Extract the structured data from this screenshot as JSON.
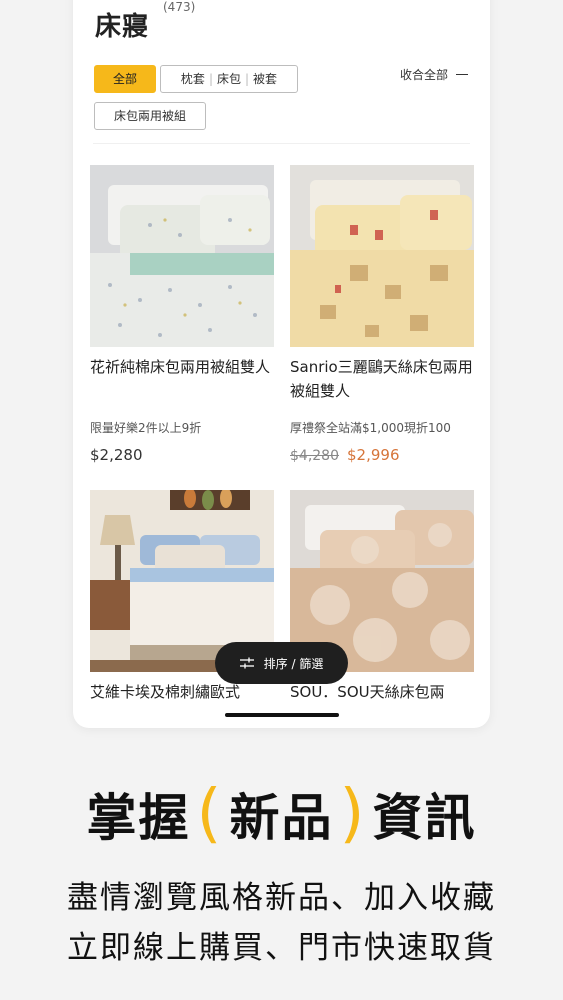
{
  "header": {
    "title": "床寢",
    "count": "(473)",
    "collapse_label": "收合全部"
  },
  "filters": {
    "all": "全部",
    "pillow": "枕套",
    "sheet": "床包",
    "quilt": "被套",
    "duvet_set": "床包兩用被組"
  },
  "products": [
    {
      "name": "花祈純棉床包兩用被組雙人",
      "promo": "限量好樂2件以上9折",
      "price": "$2,280"
    },
    {
      "name": "Sanrio三麗鷗天絲床包兩用被組雙人",
      "promo": "厚禮祭全站滿$1,000現折100",
      "old_price": "$4,280",
      "sale_price": "$2,996"
    },
    {
      "name": "艾維卡埃及棉刺繡歐式"
    },
    {
      "name": "SOU．SOU天絲床包兩"
    }
  ],
  "sort_button": "排序 / 篩選",
  "marketing": {
    "head_left": "掌握",
    "paren_open": "(",
    "head_mid": "新品",
    "paren_close": ")",
    "head_right": "資訊",
    "line1": "盡情瀏覽風格新品、加入收藏",
    "line2": "立即線上購買、門市快速取貨"
  },
  "colors": {
    "accent": "#f6b81a",
    "sale": "#d6753a"
  }
}
